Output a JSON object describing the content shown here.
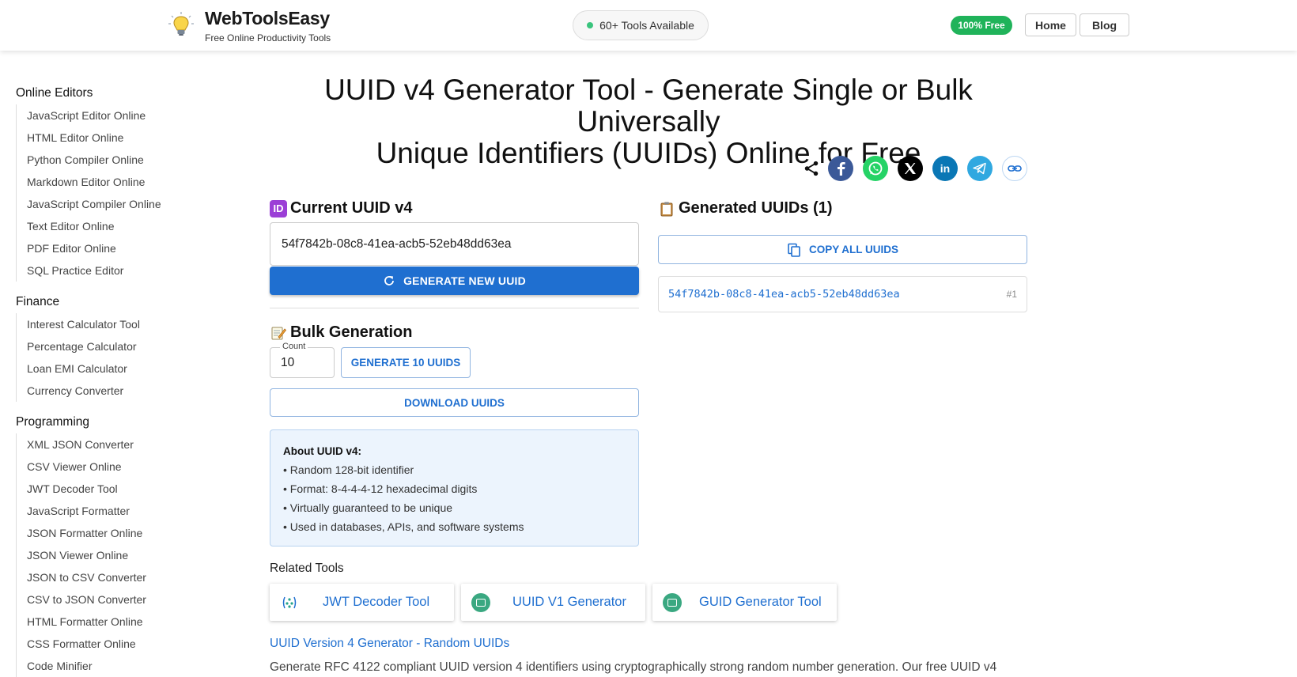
{
  "header": {
    "brand": "WebToolsEasy",
    "tagline": "Free Online Productivity Tools",
    "tools_available": "60+ Tools Available",
    "free_badge": "100% Free",
    "nav": [
      "Home",
      "Blog"
    ]
  },
  "sidebar": {
    "categories": [
      {
        "name": "Online Editors",
        "items": [
          "JavaScript Editor Online",
          "HTML Editor Online",
          "Python Compiler Online",
          "Markdown Editor Online",
          "JavaScript Compiler Online",
          "Text Editor Online",
          "PDF Editor Online",
          "SQL Practice Editor"
        ]
      },
      {
        "name": "Finance",
        "items": [
          "Interest Calculator Tool",
          "Percentage Calculator",
          "Loan EMI Calculator",
          "Currency Converter"
        ]
      },
      {
        "name": "Programming",
        "items": [
          "XML JSON Converter",
          "CSV Viewer Online",
          "JWT Decoder Tool",
          "JavaScript Formatter",
          "JSON Formatter Online",
          "JSON Viewer Online",
          "JSON to CSV Converter",
          "CSV to JSON Converter",
          "HTML Formatter Online",
          "CSS Formatter Online",
          "Code Minifier"
        ]
      }
    ]
  },
  "main": {
    "title_line1": "UUID v4 Generator Tool - Generate Single or Bulk Universally",
    "title_line2": "Unique Identifiers (UUIDs) Online for Free",
    "share_icons": [
      "share-icon",
      "facebook-icon",
      "whatsapp-icon",
      "x-icon",
      "linkedin-icon",
      "telegram-icon",
      "link-icon"
    ],
    "current": {
      "emoji": "ID",
      "title": "Current UUID v4",
      "value": "54f7842b-08c8-41ea-acb5-52eb48dd63ea",
      "generate_label": "GENERATE NEW UUID"
    },
    "bulk": {
      "title": "Bulk Generation",
      "count_label": "Count",
      "count_value": "10",
      "generate_label": "GENERATE 10 UUIDS",
      "download_label": "DOWNLOAD UUIDS"
    },
    "about": {
      "title": "About UUID v4:",
      "items": [
        "• Random 128-bit identifier",
        "• Format: 8-4-4-4-12 hexadecimal digits",
        "• Virtually guaranteed to be unique",
        "• Used in databases, APIs, and software systems"
      ]
    },
    "generated": {
      "title": "Generated UUIDs (1)",
      "copy_label": "COPY ALL UUIDS",
      "list": [
        {
          "uuid": "54f7842b-08c8-41ea-acb5-52eb48dd63ea",
          "index": "#1"
        }
      ]
    },
    "related": {
      "label": "Related Tools",
      "tools": [
        "JWT Decoder Tool",
        "UUID V1 Generator",
        "GUID Generator Tool"
      ]
    },
    "subheading": "UUID Version 4 Generator - Random UUIDs",
    "description": "Generate RFC 4122 compliant UUID version 4 identifiers using cryptographically strong random number generation. Our free UUID v4"
  },
  "colors": {
    "primary": "#1f6fd0",
    "success": "#20b35a",
    "info_bg": "#ecf4fd"
  }
}
